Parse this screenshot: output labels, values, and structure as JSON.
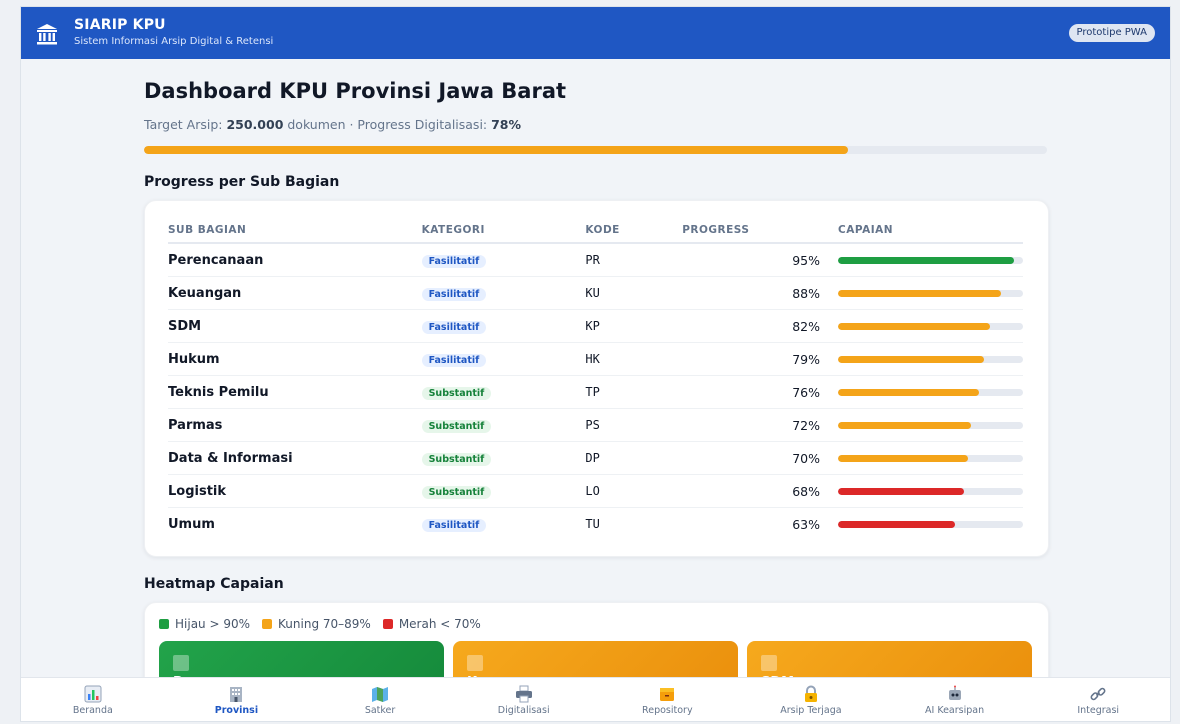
{
  "header": {
    "title": "SIARIP KPU",
    "subtitle": "Sistem Informasi Arsip Digital & Retensi",
    "badge": "Prototipe PWA",
    "logo_icon": "building-columns-icon"
  },
  "dashboard": {
    "title": "Dashboard KPU Provinsi Jawa Barat",
    "target_prefix": "Target Arsip: ",
    "target_value": "250.000",
    "target_mid": " dokumen · Progress Digitalisasi: ",
    "progress_label": "78%",
    "progress_value": 78
  },
  "colors": {
    "green": "#1e9e42",
    "yellow": "#f4a419",
    "red": "#dc2828",
    "primary": "#1f57c3"
  },
  "sub_bagian": {
    "title": "Progress per Sub Bagian",
    "headers": {
      "name": "SUB BAGIAN",
      "category": "KATEGORI",
      "code": "KODE",
      "progress": "PROGRESS",
      "achievement": "CAPAIAN"
    },
    "rows": [
      {
        "name": "Perencanaan",
        "category": "Fasilitatif",
        "code": "PR",
        "percent_label": "95%",
        "value": 95,
        "status": "green"
      },
      {
        "name": "Keuangan",
        "category": "Fasilitatif",
        "code": "KU",
        "percent_label": "88%",
        "value": 88,
        "status": "yellow"
      },
      {
        "name": "SDM",
        "category": "Fasilitatif",
        "code": "KP",
        "percent_label": "82%",
        "value": 82,
        "status": "yellow"
      },
      {
        "name": "Hukum",
        "category": "Fasilitatif",
        "code": "HK",
        "percent_label": "79%",
        "value": 79,
        "status": "yellow"
      },
      {
        "name": "Teknis Pemilu",
        "category": "Substantif",
        "code": "TP",
        "percent_label": "76%",
        "value": 76,
        "status": "yellow"
      },
      {
        "name": "Parmas",
        "category": "Substantif",
        "code": "PS",
        "percent_label": "72%",
        "value": 72,
        "status": "yellow"
      },
      {
        "name": "Data & Informasi",
        "category": "Substantif",
        "code": "DP",
        "percent_label": "70%",
        "value": 70,
        "status": "yellow"
      },
      {
        "name": "Logistik",
        "category": "Substantif",
        "code": "LO",
        "percent_label": "68%",
        "value": 68,
        "status": "red"
      },
      {
        "name": "Umum",
        "category": "Fasilitatif",
        "code": "TU",
        "percent_label": "63%",
        "value": 63,
        "status": "red"
      }
    ]
  },
  "heatmap": {
    "title": "Heatmap Capaian",
    "legend": [
      {
        "label": "Hijau > 90%",
        "status": "green"
      },
      {
        "label": "Kuning 70–89%",
        "status": "yellow"
      },
      {
        "label": "Merah < 70%",
        "status": "red"
      }
    ],
    "tiles": [
      {
        "name": "Perencanaan",
        "status": "green"
      },
      {
        "name": "Keuangan",
        "status": "yellow"
      },
      {
        "name": "SDM",
        "status": "yellow"
      }
    ]
  },
  "nav": {
    "active": "Provinsi",
    "items": [
      {
        "label": "Beranda",
        "icon": "bar-chart-icon"
      },
      {
        "label": "Provinsi",
        "icon": "office-building-icon"
      },
      {
        "label": "Satker",
        "icon": "map-icon"
      },
      {
        "label": "Digitalisasi",
        "icon": "printer-icon"
      },
      {
        "label": "Repository",
        "icon": "file-cabinet-icon"
      },
      {
        "label": "Arsip Terjaga",
        "icon": "lock-key-icon"
      },
      {
        "label": "AI Kearsipan",
        "icon": "robot-icon"
      },
      {
        "label": "Integrasi",
        "icon": "link-icon"
      }
    ]
  }
}
